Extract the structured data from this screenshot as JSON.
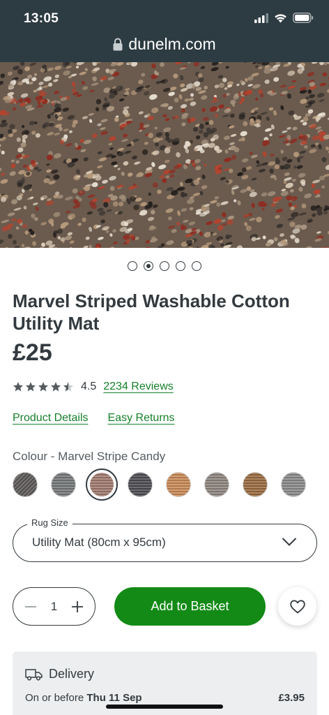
{
  "status_bar": {
    "time": "13:05",
    "icons": [
      "signal-icon",
      "wifi-icon",
      "battery-icon"
    ]
  },
  "browser": {
    "url": "dunelm.com",
    "lock_icon": "lock-icon"
  },
  "gallery": {
    "image_count": 5,
    "active_index": 1
  },
  "product": {
    "title": "Marvel Striped Washable Cotton Utility Mat",
    "price": "£25",
    "rating": {
      "value": "4.5",
      "stars_filled": 4.5,
      "stars_max": 5,
      "reviews_label": "2234 Reviews"
    },
    "links": {
      "details": "Product Details",
      "returns": "Easy Returns"
    }
  },
  "colour": {
    "label": "Colour - Marvel Stripe Candy",
    "selected_index": 2,
    "swatches": [
      {
        "name": "swatch-1",
        "color": "#5a5756"
      },
      {
        "name": "swatch-2",
        "color": "#75787a"
      },
      {
        "name": "swatch-3",
        "color": "#a07a6e"
      },
      {
        "name": "swatch-4",
        "color": "#4c4c52"
      },
      {
        "name": "swatch-5",
        "color": "#c98a55"
      },
      {
        "name": "swatch-6",
        "color": "#8e857e"
      },
      {
        "name": "swatch-7",
        "color": "#9a6b3f"
      },
      {
        "name": "swatch-8",
        "color": "#8a8a8a"
      }
    ]
  },
  "size": {
    "legend": "Rug Size",
    "value": "Utility Mat (80cm x 95cm)"
  },
  "quantity": {
    "value": "1"
  },
  "actions": {
    "add_to_basket": "Add to Basket"
  },
  "delivery": {
    "heading": "Delivery",
    "prefix": "On or before",
    "date": "Thu 11 Sep",
    "price": "£3.95"
  },
  "colors": {
    "accent": "#138a16",
    "link": "#16802a",
    "header": "#2d3b42",
    "text": "#333a3f"
  }
}
